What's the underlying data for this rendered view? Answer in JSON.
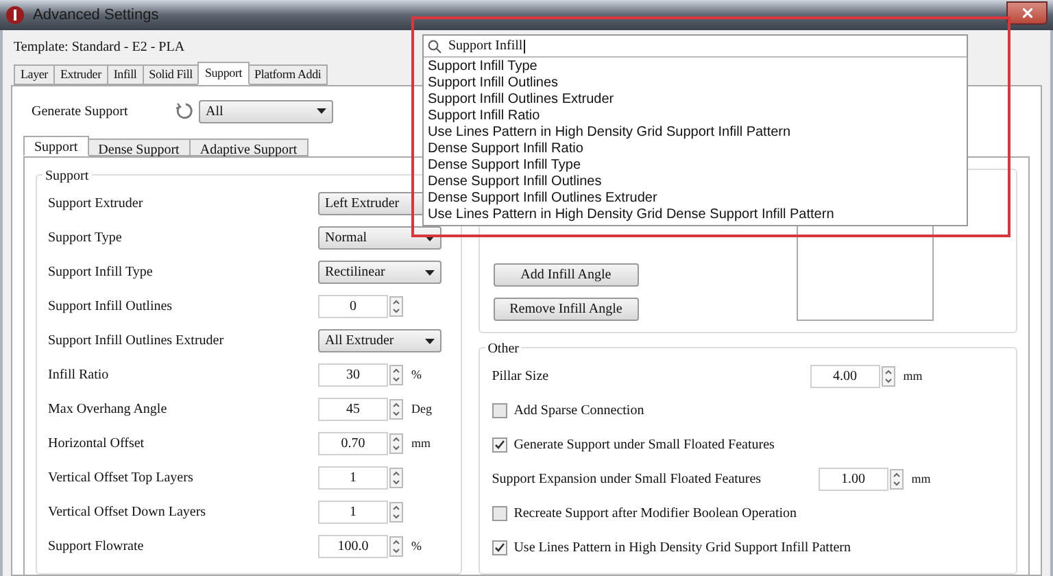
{
  "window": {
    "title": "Advanced Settings"
  },
  "template": "Template: Standard - E2 - PLA",
  "tabs": [
    {
      "label": "Layer",
      "selected": false
    },
    {
      "label": "Extruder",
      "selected": false
    },
    {
      "label": "Infill",
      "selected": false
    },
    {
      "label": "Solid Fill",
      "selected": false
    },
    {
      "label": "Support",
      "selected": true
    },
    {
      "label": "Platform Addi",
      "selected": false
    }
  ],
  "generate_support": {
    "label": "Generate Support",
    "value": "All"
  },
  "subtabs": [
    {
      "label": "Support",
      "selected": true
    },
    {
      "label": "Dense Support",
      "selected": false
    },
    {
      "label": "Adaptive Support",
      "selected": false
    }
  ],
  "support_group": {
    "title": "Support",
    "rows": [
      {
        "kind": "dropdown",
        "label": "Support Extruder",
        "value": "Left Extruder"
      },
      {
        "kind": "dropdown",
        "label": "Support Type",
        "value": "Normal"
      },
      {
        "kind": "dropdown",
        "label": "Support Infill Type",
        "value": "Rectilinear"
      },
      {
        "kind": "spin",
        "label": "Support Infill Outlines",
        "value": "0"
      },
      {
        "kind": "dropdown",
        "label": "Support Infill Outlines Extruder",
        "value": "All Extruder"
      },
      {
        "kind": "spin",
        "label": "Infill Ratio",
        "value": "30",
        "unit": "%"
      },
      {
        "kind": "spin",
        "label": "Max Overhang Angle",
        "value": "45",
        "unit": "Deg"
      },
      {
        "kind": "spin",
        "label": "Horizontal Offset",
        "value": "0.70",
        "unit": "mm"
      },
      {
        "kind": "spin",
        "label": "Vertical Offset Top Layers",
        "value": "1"
      },
      {
        "kind": "spin",
        "label": "Vertical Offset Down Layers",
        "value": "1"
      },
      {
        "kind": "spin",
        "label": "Support Flowrate",
        "value": "100.0",
        "unit": "%"
      }
    ]
  },
  "angle_buttons": [
    "Add Infill Angle",
    "Remove Infill Angle"
  ],
  "other_group": {
    "title": "Other",
    "rows": [
      {
        "kind": "spin",
        "label": "Pillar Size",
        "value": "4.00",
        "unit": "mm"
      },
      {
        "kind": "checkbox",
        "label": "Add Sparse Connection",
        "checked": false
      },
      {
        "kind": "checkbox",
        "label": "Generate Support under Small Floated Features",
        "checked": true
      },
      {
        "kind": "spin",
        "label": "Support Expansion under Small Floated Features",
        "value": "1.00",
        "unit": "mm"
      },
      {
        "kind": "checkbox",
        "label": "Recreate Support after Modifier Boolean Operation",
        "checked": false
      },
      {
        "kind": "checkbox",
        "label": "Use Lines Pattern in High Density Grid Support Infill Pattern",
        "checked": true
      }
    ]
  },
  "search": {
    "value": "Support Infill",
    "results": [
      "Support Infill Type",
      "Support Infill Outlines",
      "Support Infill Outlines Extruder",
      "Support Infill Ratio",
      "Use Lines Pattern in High Density Grid Support Infill Pattern",
      "Dense Support Infill Ratio",
      "Dense Support Infill Type",
      "Dense Support Infill Outlines",
      "Dense Support Infill Outlines Extruder",
      "Use Lines Pattern in High Density Grid Dense Support Infill Pattern"
    ]
  }
}
